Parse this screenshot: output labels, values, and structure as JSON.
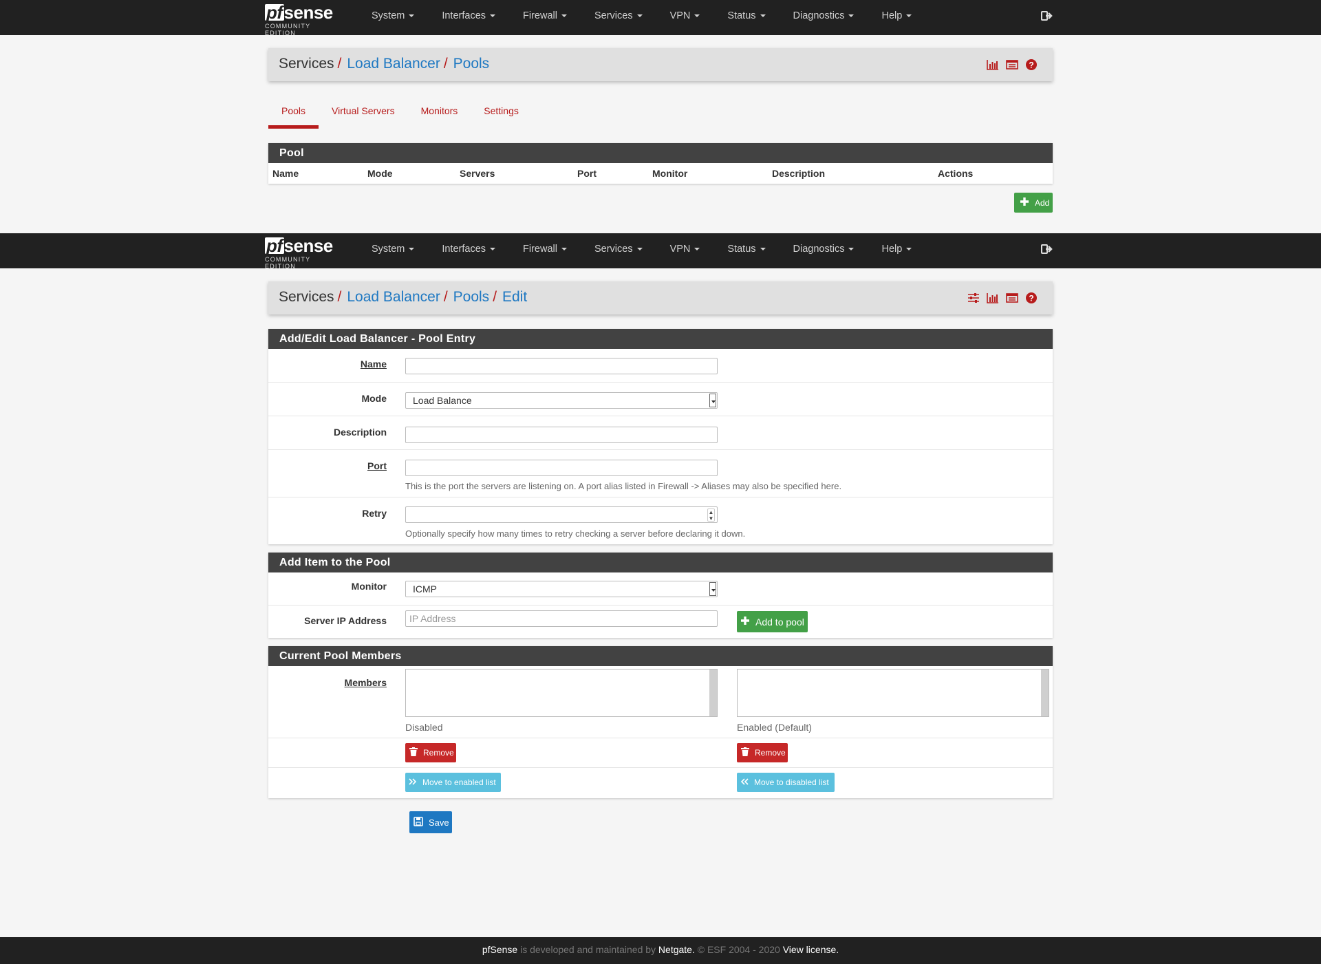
{
  "brand": {
    "logo_pf": "pf",
    "logo_sense": "sense",
    "edition": "COMMUNITY EDITION"
  },
  "nav": {
    "items": [
      "System",
      "Interfaces",
      "Firewall",
      "Services",
      "VPN",
      "Status",
      "Diagnostics",
      "Help"
    ],
    "logout_icon": "sign-out-icon"
  },
  "list_page": {
    "breadcrumb": {
      "root": "Services",
      "level1": "Load Balancer",
      "level2": "Pools"
    },
    "tabs": [
      "Pools",
      "Virtual Servers",
      "Monitors",
      "Settings"
    ],
    "active_tab": "Pools",
    "panel_title": "Pool",
    "columns": [
      "Name",
      "Mode",
      "Servers",
      "Port",
      "Monitor",
      "Description",
      "Actions"
    ],
    "add_button": "Add"
  },
  "edit_page": {
    "breadcrumb": {
      "root": "Services",
      "level1": "Load Balancer",
      "level2": "Pools",
      "level3": "Edit"
    },
    "section_pool_entry": "Add/Edit Load Balancer - Pool Entry",
    "fields": {
      "name_label": "Name",
      "name_value": "",
      "mode_label": "Mode",
      "mode_value": "Load Balance",
      "description_label": "Description",
      "description_value": "",
      "port_label": "Port",
      "port_value": "",
      "port_help": "This is the port the servers are listening on. A port alias listed in Firewall -> Aliases may also be specified here.",
      "retry_label": "Retry",
      "retry_value": "",
      "retry_help": "Optionally specify how many times to retry checking a server before declaring it down."
    },
    "section_add_item": "Add Item to the Pool",
    "add_item": {
      "monitor_label": "Monitor",
      "monitor_value": "ICMP",
      "server_ip_label": "Server IP Address",
      "server_ip_placeholder": "IP Address",
      "add_to_pool_button": "Add to pool"
    },
    "section_members": "Current Pool Members",
    "members": {
      "label": "Members",
      "disabled_caption": "Disabled",
      "enabled_caption": "Enabled (Default)",
      "remove_button": "Remove",
      "move_to_enabled": "Move to enabled list",
      "move_to_disabled": "Move to disabled list"
    },
    "save_button": "Save"
  },
  "footer": {
    "brand": "pfSense",
    "text1": " is developed and maintained by ",
    "company": "Netgate.",
    "text2": " © ESF 2004 - 2020 ",
    "license": "View license."
  },
  "colors": {
    "navbar": "#212121",
    "accent_red": "#b71c1c",
    "link_blue": "#1e78c2",
    "panel_heading": "#424242",
    "success": "#43a047",
    "info": "#5bc0de"
  }
}
